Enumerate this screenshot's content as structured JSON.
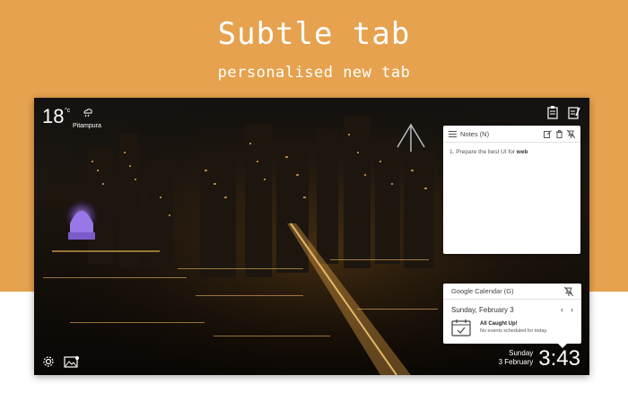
{
  "promo": {
    "title": "Subtle tab",
    "subtitle": "personalised new tab",
    "background_color": "#e6a24e"
  },
  "weather": {
    "temperature": "18",
    "unit": "°c",
    "condition_icon": "cloud-rain-icon",
    "location": "Pitampura"
  },
  "top_icons": [
    "clipboard-icon",
    "notes-edit-icon"
  ],
  "notes_widget": {
    "title": "Notes (N)",
    "actions": [
      "edit-icon",
      "trash-icon",
      "pin-off-icon"
    ],
    "item_text": "1. Prepare the best UI for ",
    "item_bold": "web"
  },
  "calendar_widget": {
    "title": "Google Calendar (G)",
    "date_label": "Sunday, February 3",
    "prev": "‹",
    "next": "›",
    "empty_title": "All Caught Up!",
    "empty_subtitle": "No events scheduled for today."
  },
  "bottom_icons": [
    "gear-icon",
    "image-user-icon"
  ],
  "clock": {
    "day": "Sunday",
    "date": "3 February",
    "time": "3:43"
  }
}
